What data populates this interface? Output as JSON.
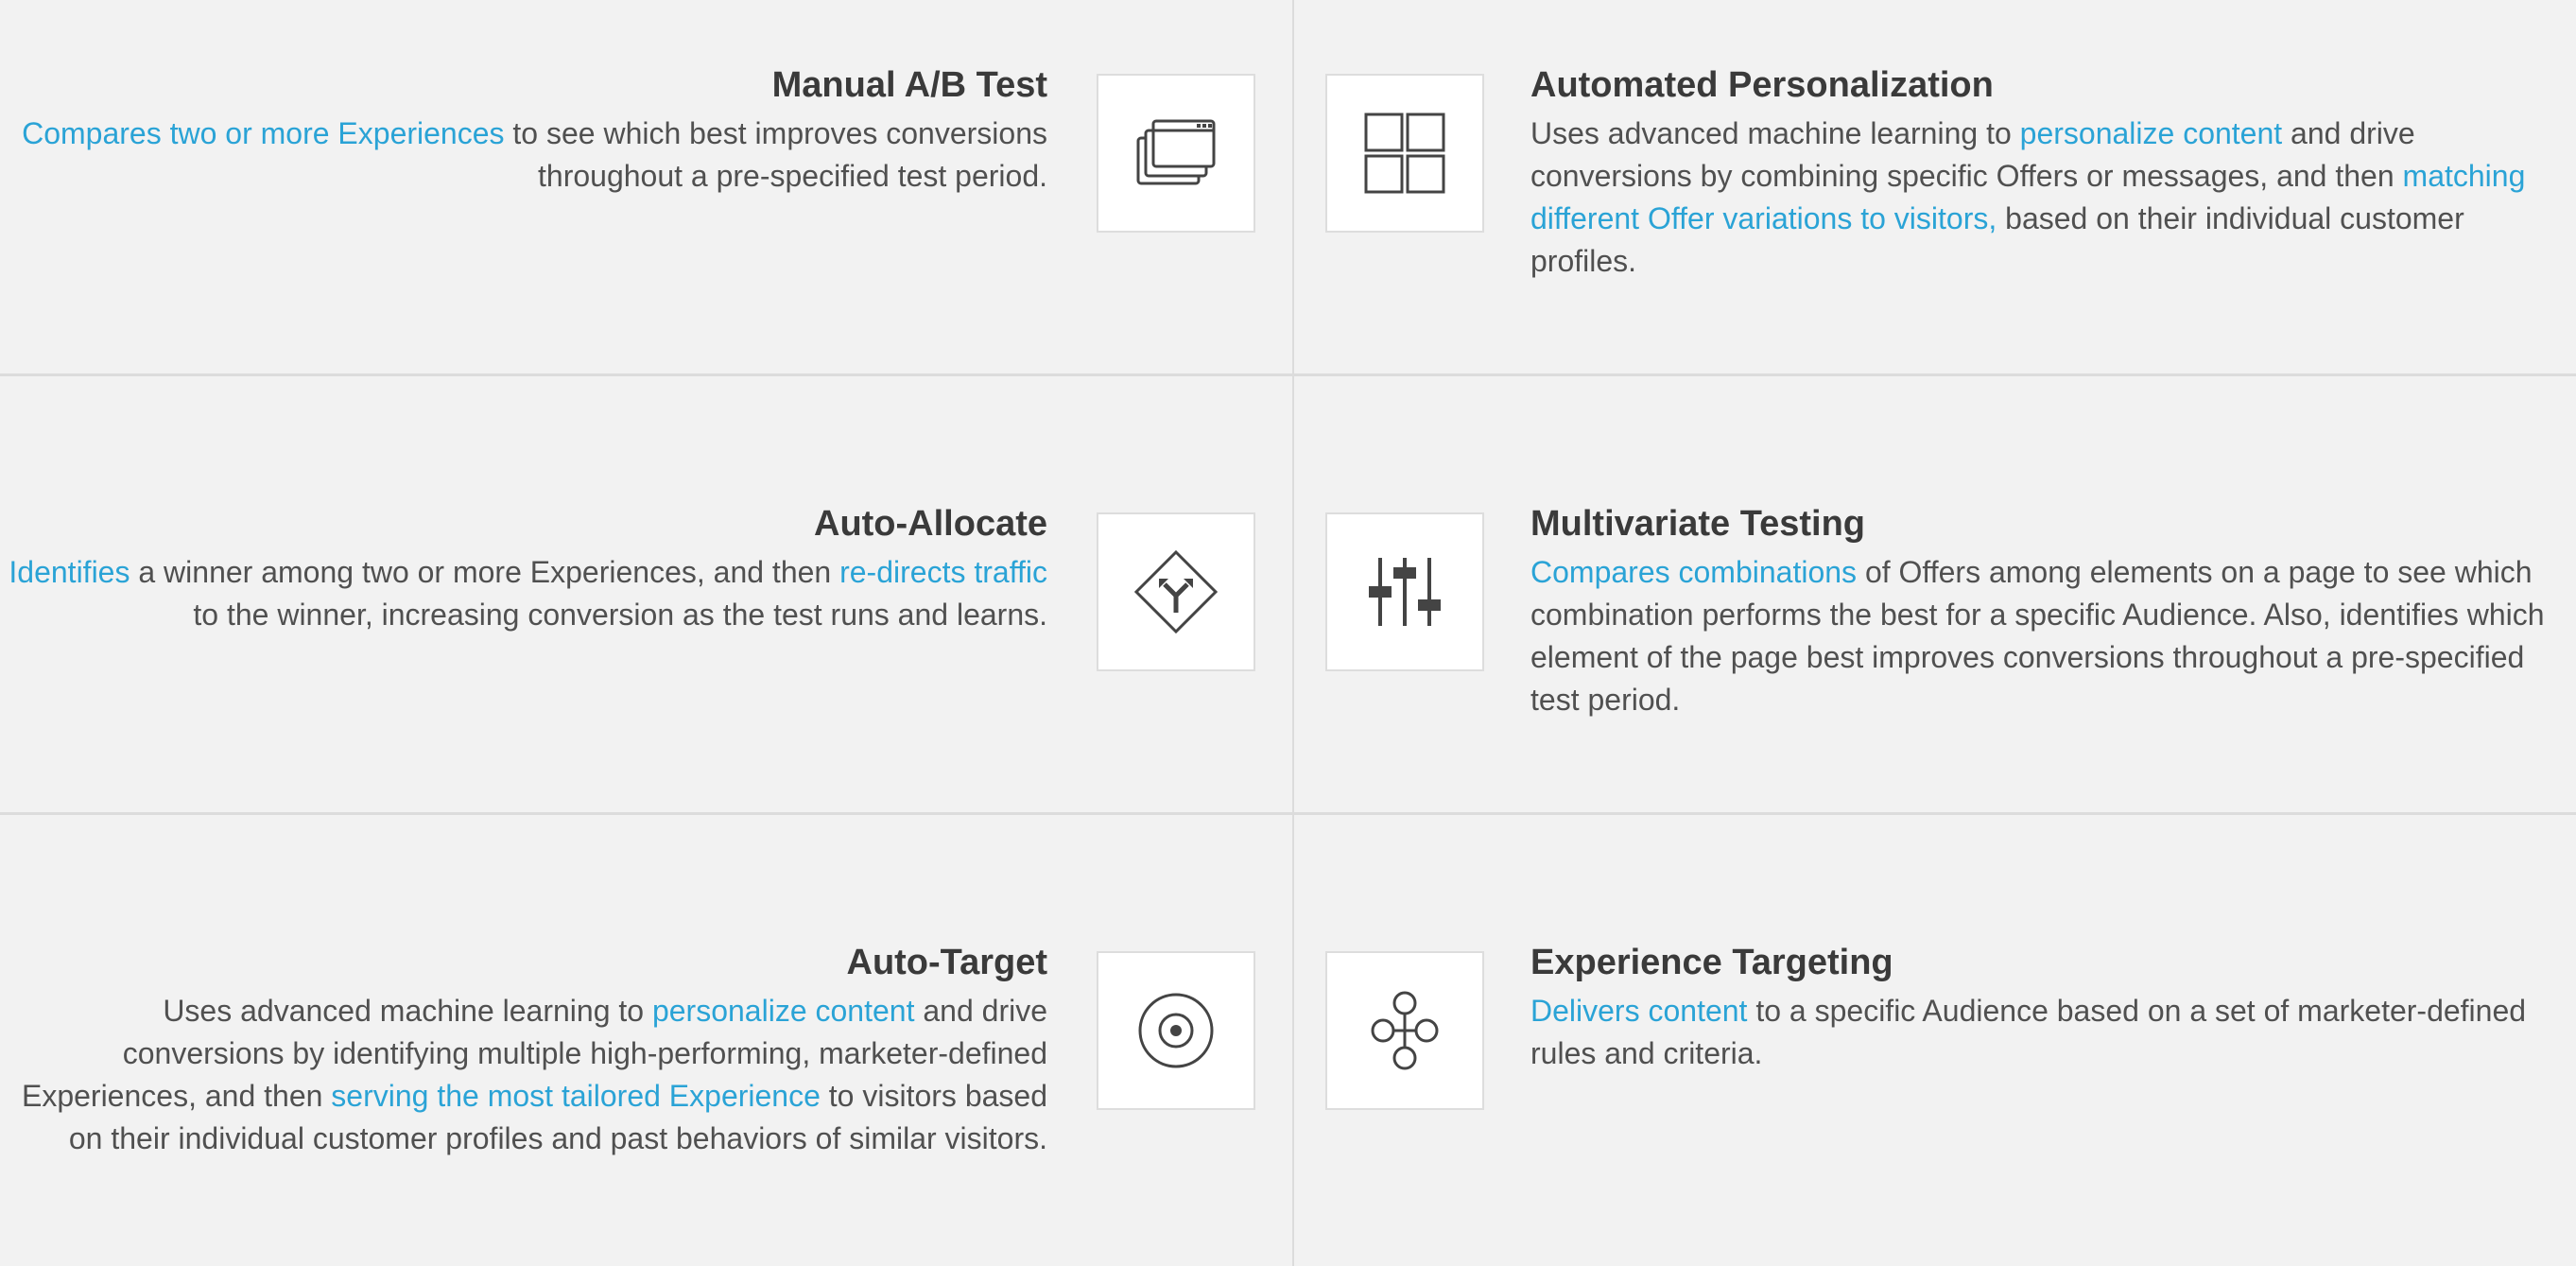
{
  "colors": {
    "background": "#f2f2f2",
    "link": "#2aa3d6",
    "title": "#3a3a3a",
    "text": "#505050",
    "icon": "#444444"
  },
  "cards": {
    "manual_ab": {
      "title": "Manual A/B Test",
      "icon": "browser-windows-icon",
      "link1": "Compares two or more Experiences",
      "text1": " to see which best improves conversions throughout a pre-specified test period."
    },
    "auto_personalization": {
      "title": "Automated Personalization",
      "icon": "four-squares-grid-icon",
      "text1": "Uses advanced machine learning to ",
      "link1": "personalize content",
      "text2": " and drive conversions by combining specific Offers or messages, and then ",
      "link2": "matching different Offer variations to visitors,",
      "text3": " based on their individual customer profiles."
    },
    "auto_allocate": {
      "title": "Auto-Allocate",
      "icon": "route-sign-icon",
      "link1": "Identifies",
      "text1": " a winner among two or more Experiences, and then ",
      "link2": "re-directs traffic",
      "text2": " to the winner, increasing conversion as the test runs and learns."
    },
    "multivariate": {
      "title": "Multivariate Testing",
      "icon": "sliders-icon",
      "link1": "Compares combinations",
      "text1": " of Offers among elements on a page to see which combination performs the best for a specific Audience. Also, identifies which element of the page best improves conversions throughout a pre-specified test period."
    },
    "auto_target": {
      "title": "Auto-Target",
      "icon": "target-icon",
      "text1": "Uses advanced machine learning to ",
      "link1": "personalize content",
      "text2": " and drive conversions by identifying multiple high-performing, marketer-defined Experiences, and then ",
      "link2": "serving the most tailored Experience",
      "text3": " to visitors based on their individual customer profiles and past behaviors of similar visitors."
    },
    "experience_targeting": {
      "title": "Experience Targeting",
      "icon": "flow-nodes-icon",
      "link1": "Delivers content",
      "text1": " to a specific Audience based on a set of marketer-defined rules and criteria."
    }
  }
}
